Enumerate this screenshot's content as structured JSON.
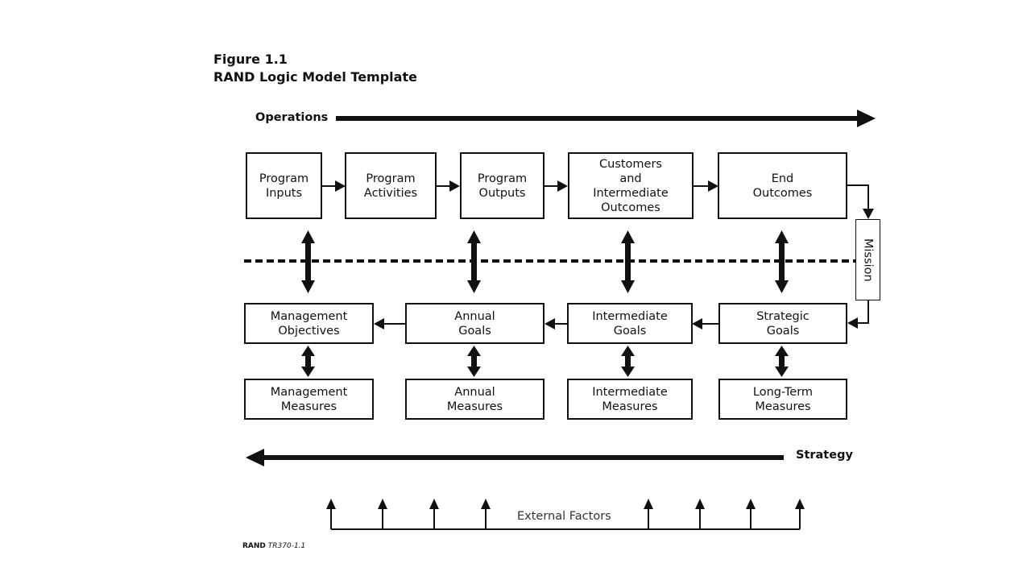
{
  "figure": {
    "number": "Figure 1.1",
    "title": "RAND Logic Model Template"
  },
  "operations_label": "Operations",
  "strategy_label": "Strategy",
  "mission_label": "Mission",
  "external_factors_label": "External Factors",
  "source": {
    "org": "RAND",
    "id": "TR370-1.1"
  },
  "top_row": [
    {
      "label": "Program\nInputs"
    },
    {
      "label": "Program\nActivities"
    },
    {
      "label": "Program\nOutputs"
    },
    {
      "label": "Customers\nand\nIntermediate\nOutcomes"
    },
    {
      "label": "End\nOutcomes"
    }
  ],
  "goals_row": [
    {
      "label": "Management\nObjectives"
    },
    {
      "label": "Annual\nGoals"
    },
    {
      "label": "Intermediate\nGoals"
    },
    {
      "label": "Strategic\nGoals"
    }
  ],
  "measures_row": [
    {
      "label": "Management\nMeasures"
    },
    {
      "label": "Annual\nMeasures"
    },
    {
      "label": "Intermediate\nMeasures"
    },
    {
      "label": "Long-Term\nMeasures"
    }
  ]
}
